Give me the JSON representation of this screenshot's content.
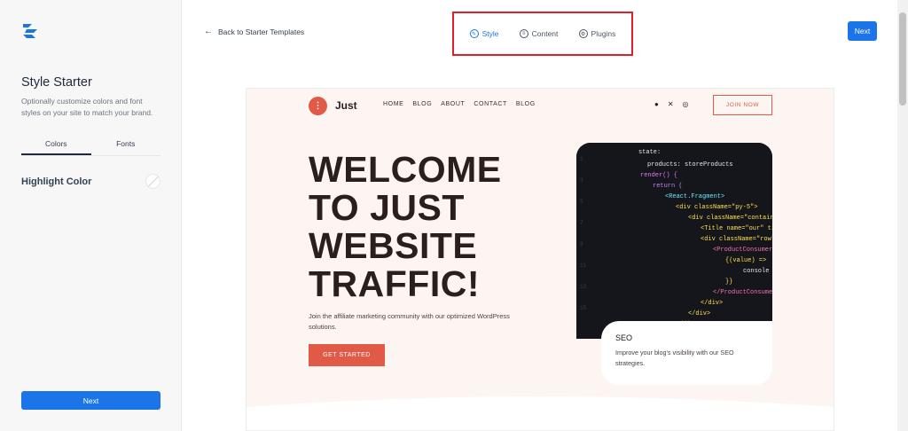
{
  "sidebar": {
    "title": "Style Starter",
    "description": "Optionally customize colors and font styles on your site to match your brand.",
    "tabs": [
      {
        "label": "Colors"
      },
      {
        "label": "Fonts"
      }
    ],
    "highlight_label": "Highlight Color",
    "next_label": "Next"
  },
  "topbar": {
    "back_label": "Back to Starter Templates",
    "steps": [
      {
        "label": "Style"
      },
      {
        "label": "Content"
      },
      {
        "label": "Plugins"
      }
    ],
    "next_label": "Next"
  },
  "preview": {
    "brand": "Just",
    "nav": [
      "HOME",
      "BLOG",
      "ABOUT",
      "CONTACT",
      "BLOG"
    ],
    "join_label": "JOIN NOW",
    "hero_title": "WELCOME TO JUST WEBSITE TRAFFIC!",
    "hero_desc": "Join the affiliate marketing community with our optimized WordPress solutions.",
    "hero_button": "GET STARTED",
    "seo_title": "SEO",
    "seo_desc": "Improve your blog's visibility with our SEO strategies."
  },
  "colors": {
    "accent": "#1b74e8",
    "brand": "#e05a47",
    "highlight": "#e11d2e",
    "preview_bg": "#fdf5f1"
  },
  "icons": [
    "starter-templates-logo-icon",
    "back-arrow-icon",
    "style-step-icon",
    "content-step-icon",
    "plugins-step-icon",
    "facebook-icon",
    "x-icon",
    "instagram-icon"
  ]
}
